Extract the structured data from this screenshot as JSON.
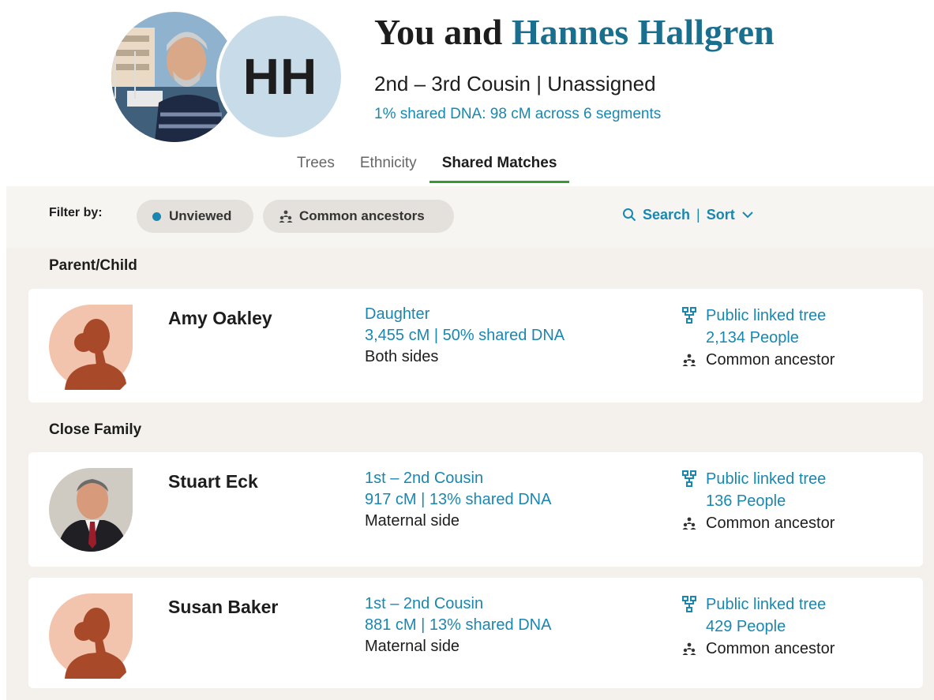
{
  "header": {
    "title_prefix": "You and",
    "title_name": "Hannes Hallgren",
    "initials": "HH",
    "relationship": "2nd – 3rd Cousin | Unassigned",
    "shared_dna": "1% shared DNA: 98 cM across 6 segments"
  },
  "tabs": [
    {
      "label": "Trees",
      "active": false
    },
    {
      "label": "Ethnicity",
      "active": false
    },
    {
      "label": "Shared Matches",
      "active": true
    }
  ],
  "filter": {
    "label": "Filter by:",
    "chip_unviewed": "Unviewed",
    "chip_ancestors": "Common ancestors",
    "search": "Search",
    "separator": "|",
    "sort": "Sort"
  },
  "sections": [
    {
      "label": "Parent/Child"
    },
    {
      "label": "Close Family"
    }
  ],
  "matches": [
    {
      "name": "Amy Oakley",
      "relationship": "Daughter",
      "dna": "3,455 cM | 50% shared DNA",
      "side": "Both sides",
      "tree": "Public linked tree",
      "people": "2,134 People",
      "ancestor": "Common ancestor",
      "avatar": "silhouette"
    },
    {
      "name": "Stuart Eck",
      "relationship": "1st – 2nd Cousin",
      "dna": "917 cM | 13% shared DNA",
      "side": "Maternal side",
      "tree": "Public linked tree",
      "people": "136 People",
      "ancestor": "Common ancestor",
      "avatar": "photo"
    },
    {
      "name": "Susan Baker",
      "relationship": "1st – 2nd Cousin",
      "dna": "881 cM | 13% shared DNA",
      "side": "Maternal side",
      "tree": "Public linked tree",
      "people": "429 People",
      "ancestor": "Common ancestor",
      "avatar": "silhouette"
    }
  ],
  "colors": {
    "accent_blue": "#1a87b0",
    "title_blue": "#1a6e8e",
    "tab_underline": "#3a9a2f",
    "silhouette_bg": "#f2c4ad",
    "silhouette_fg": "#a8492a"
  }
}
